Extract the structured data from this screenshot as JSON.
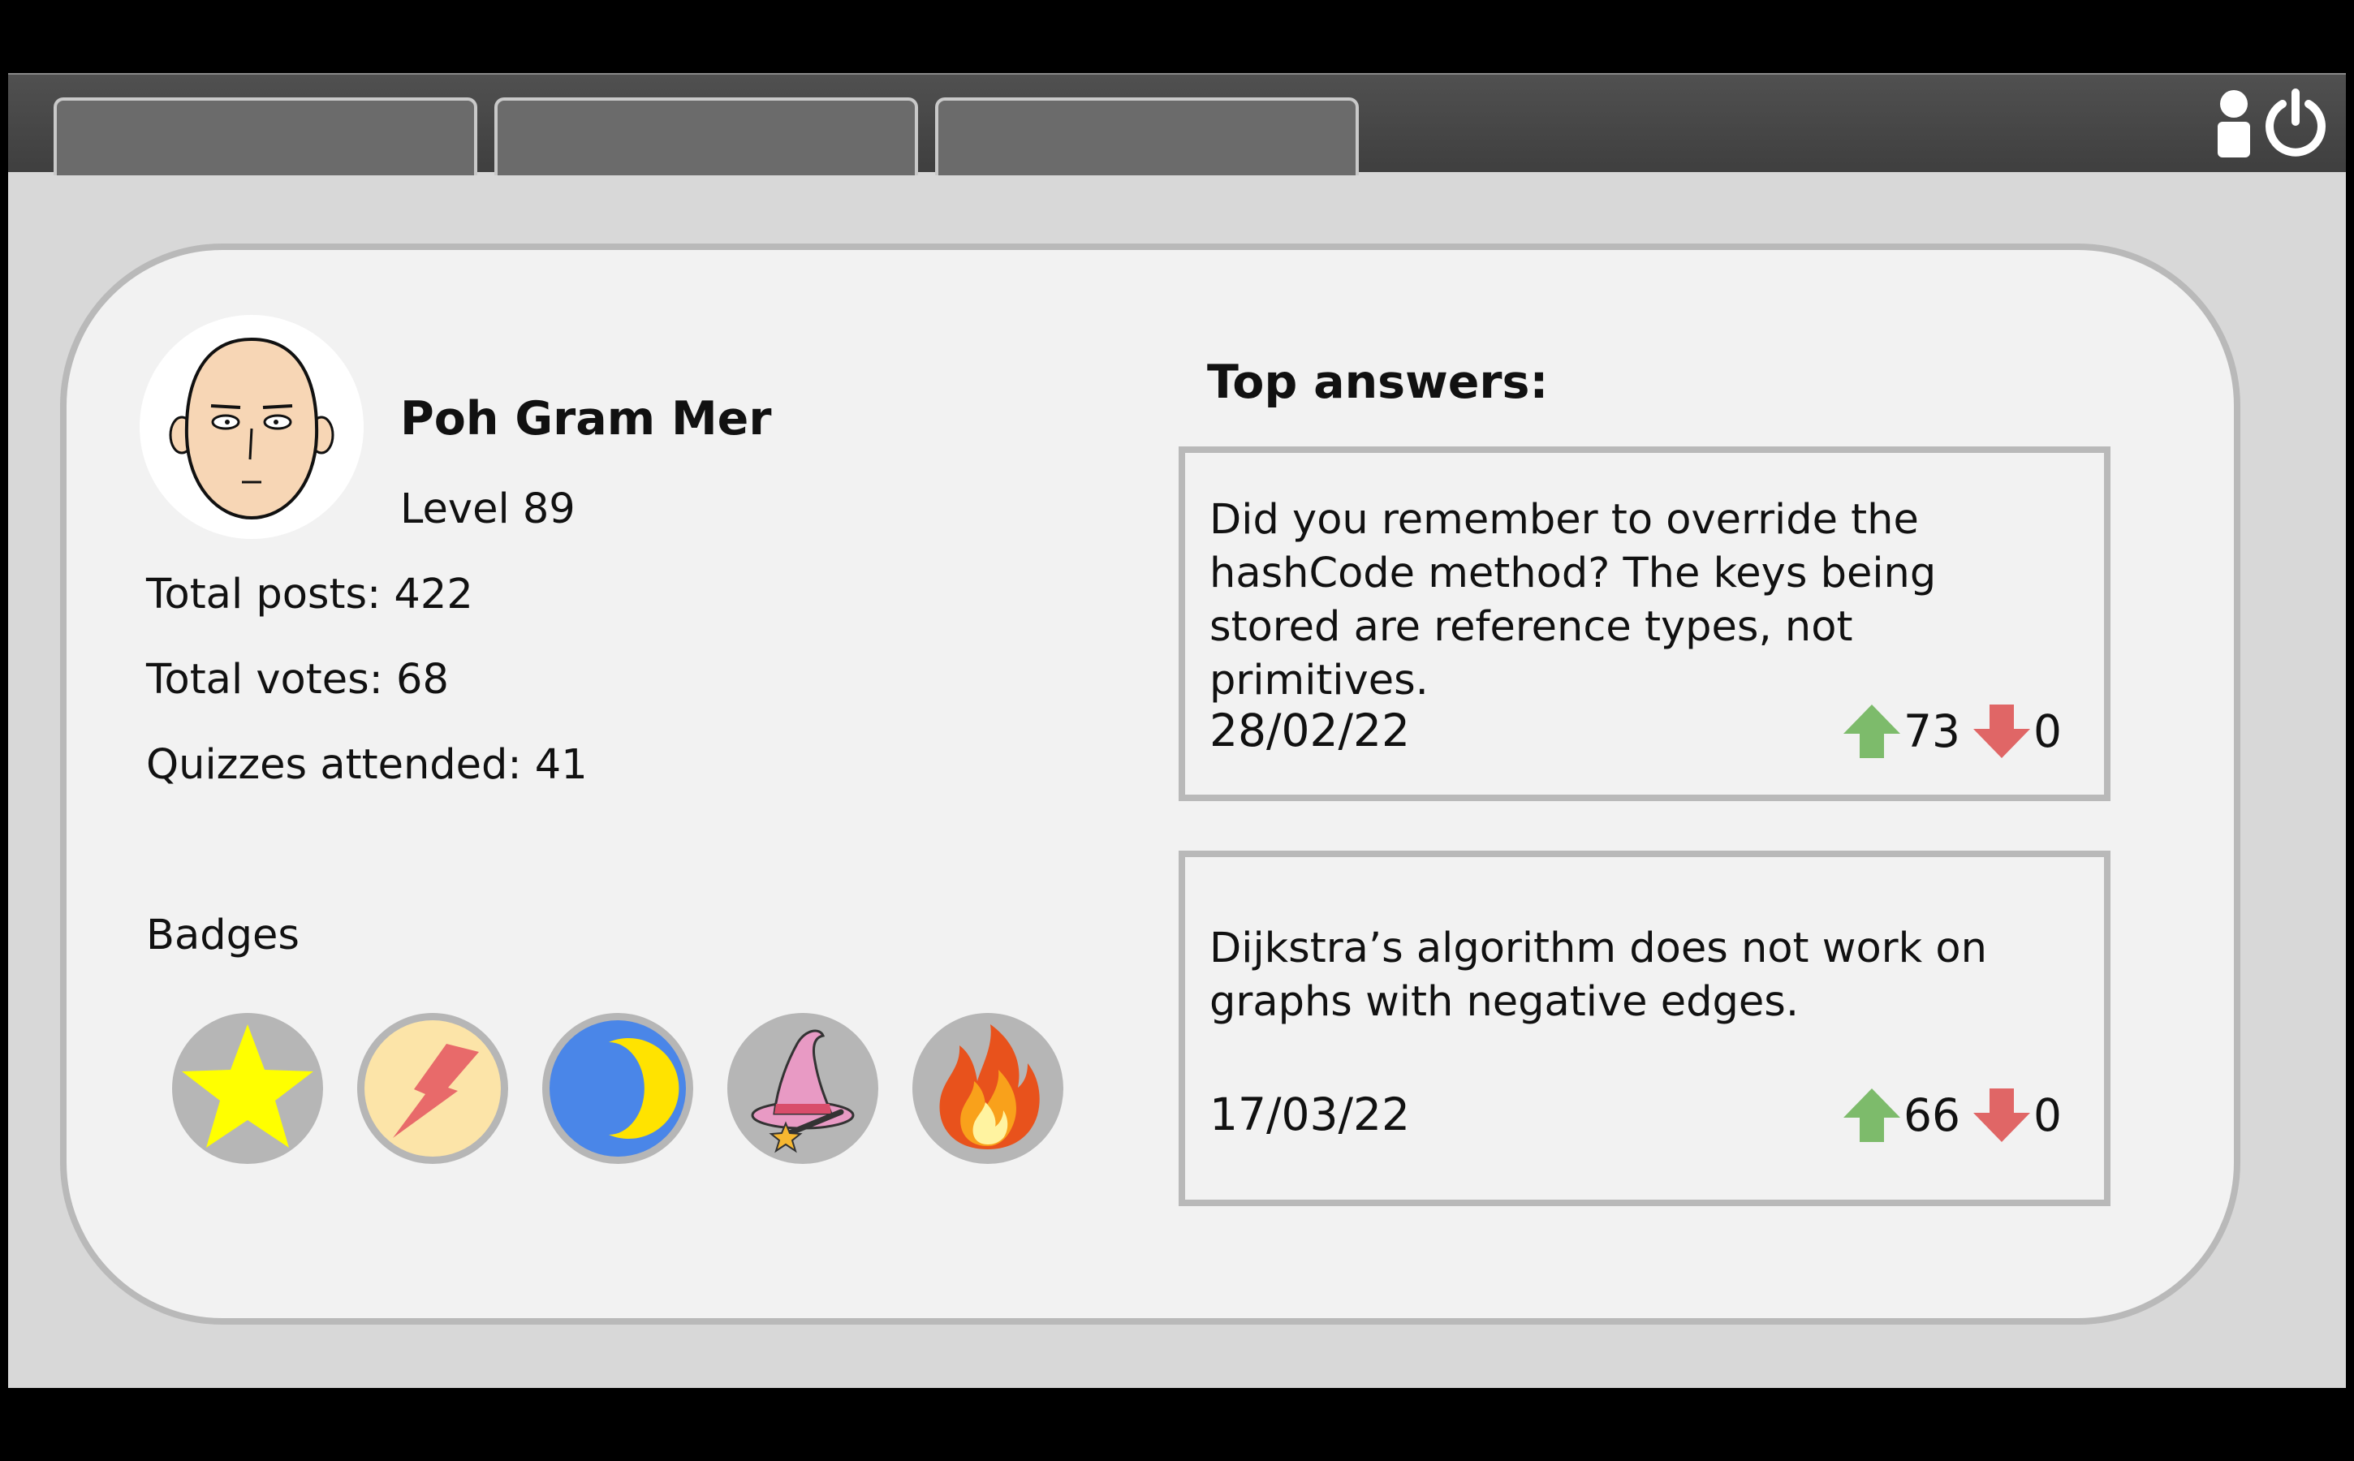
{
  "colors": {
    "frame": "#000000",
    "nav_bar": "#474747",
    "tab": "#6b6b6b",
    "background": "#d8d8d8",
    "card": "#f2f2f2",
    "card_border": "#b9b9b9",
    "upvote": "#7dbb6b",
    "downvote": "#e06666"
  },
  "nav": {
    "tabs": [
      "",
      "",
      ""
    ],
    "icons": [
      "user-icon",
      "power-icon"
    ]
  },
  "profile": {
    "name": "Poh Gram Mer",
    "level": "Level 89",
    "stats": {
      "posts": "Total posts: 422",
      "votes": "Total votes: 68",
      "quizzes": "Quizzes attended: 41"
    },
    "badges_label": "Badges",
    "badges": [
      "star-badge-icon",
      "lightning-badge-icon",
      "moon-badge-icon",
      "wizard-hat-badge-icon",
      "fire-badge-icon"
    ]
  },
  "top_answers": {
    "title": "Top answers:",
    "items": [
      {
        "text": "Did you remember to override the hashCode method? The keys being stored are reference types, not primitives.",
        "date": "28/02/22",
        "upvotes": "73",
        "downvotes": "0"
      },
      {
        "text": "Dijkstra’s algorithm does not work on graphs with negative edges.",
        "date": "17/03/22",
        "upvotes": "66",
        "downvotes": "0"
      }
    ]
  }
}
